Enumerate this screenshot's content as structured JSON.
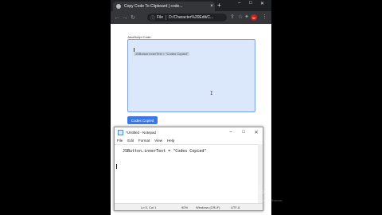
{
  "browser": {
    "tab_title": "Copy Code To Clipboard | code...",
    "tab_close": "×",
    "new_tab": "+",
    "omnibox_info": "ⓘ",
    "omnibox_scheme": "File",
    "url": "D:/Character%20Edit/C...",
    "profile_initial": "W"
  },
  "page": {
    "textarea_label": "JavaScript Code:",
    "textarea_content": "JSButton.innerText = \"Codes Copied\"",
    "copy_button": "Codes Copied"
  },
  "notepad": {
    "title": "*Untitled - Notepad",
    "menu": [
      "File",
      "Edit",
      "Format",
      "View",
      "Help"
    ],
    "content": "JSButton.innerText = \"Codes Copied\"",
    "status": {
      "position": "Ln 5, Col 1",
      "zoom": "90%",
      "line_ending": "Windows (CRLF)",
      "encoding": "UTF-8"
    }
  },
  "watermark": {
    "line1": "Activate Windows",
    "line2": "Go to Settings to activate Windows."
  }
}
